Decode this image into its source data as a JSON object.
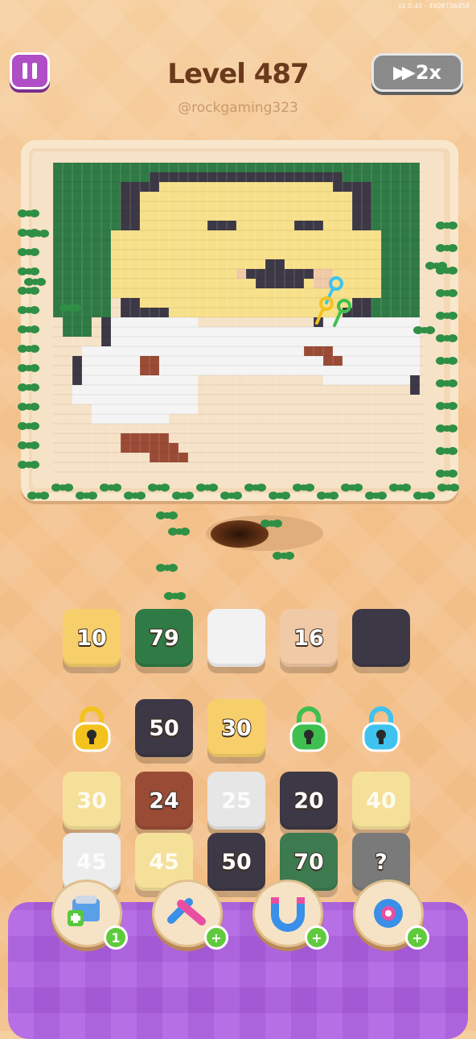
{
  "version": "v1.0.43 - 4908736458",
  "level": "Level 487",
  "username": "@rockgaming323",
  "speed_label": "2x",
  "colors": {
    "pause": "#b04ec5",
    "speed": "#8a8a8a",
    "booster_tray": "#b267e4"
  },
  "queue": [
    {
      "value": "10",
      "color": "#f7cf6a"
    },
    {
      "value": "79",
      "color": "#2f7a45"
    },
    {
      "value": "",
      "color": "#f2f2f2"
    },
    {
      "value": "16",
      "color": "#f0c9a6"
    },
    {
      "value": "",
      "color": "#3d3845"
    }
  ],
  "grid_row1": [
    {
      "kind": "lock",
      "icon": "yellow-lock-icon",
      "color": "#f4c21f"
    },
    {
      "value": "50",
      "color": "#3d3845"
    },
    {
      "value": "30",
      "color": "#f7cf6a"
    },
    {
      "kind": "lock",
      "icon": "green-lock-icon",
      "color": "#3fbf4f"
    },
    {
      "kind": "lock",
      "icon": "blue-lock-icon",
      "color": "#3fc3ee"
    }
  ],
  "grid_row2": [
    {
      "value": "30",
      "color": "#f5e09a"
    },
    {
      "value": "24",
      "color": "#9a4b36"
    },
    {
      "value": "25",
      "color": "#e6e6e6"
    },
    {
      "value": "20",
      "color": "#3d3845"
    },
    {
      "value": "40",
      "color": "#f5e09a"
    }
  ],
  "grid_row3": [
    {
      "value": "45",
      "color": "#ececec"
    },
    {
      "value": "45",
      "color": "#f5e09a"
    },
    {
      "value": "50",
      "color": "#3d3845"
    },
    {
      "value": "70",
      "color": "#3d7a50"
    },
    {
      "value": "?",
      "color": "#7a7a7a"
    }
  ],
  "boosters": [
    {
      "name": "add-box",
      "icon": "add-box-icon",
      "badge": "1"
    },
    {
      "name": "swap",
      "icon": "swap-arrows-icon",
      "badge": "+"
    },
    {
      "name": "magnet",
      "icon": "magnet-icon",
      "badge": "+"
    },
    {
      "name": "vacuum",
      "icon": "vacuum-icon",
      "badge": "+"
    }
  ]
}
